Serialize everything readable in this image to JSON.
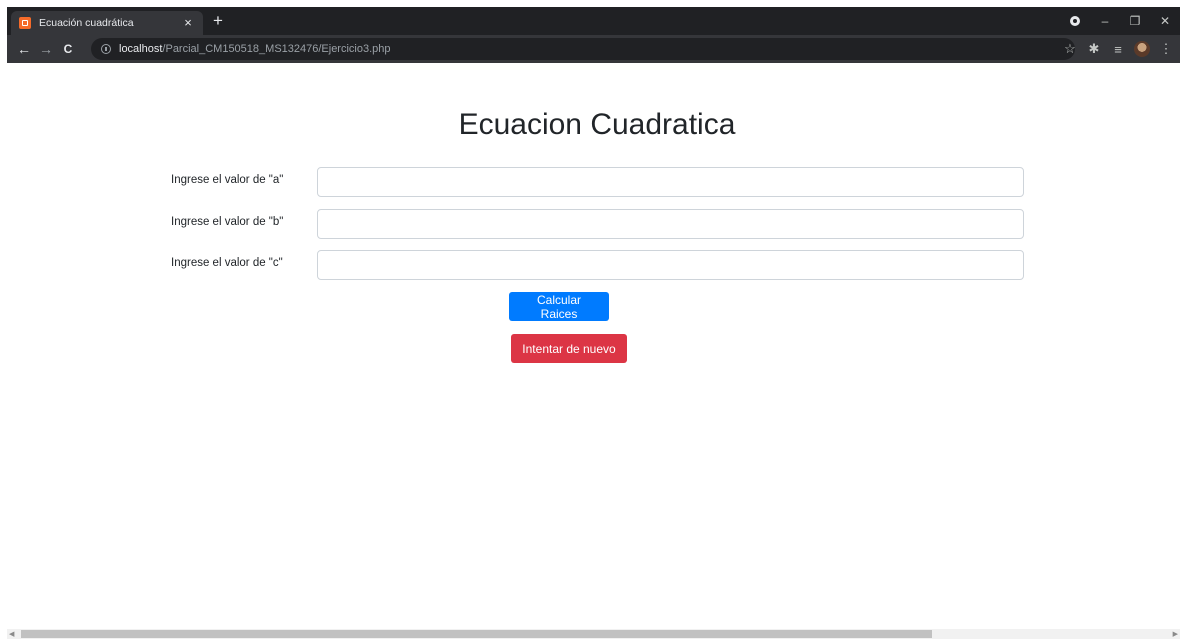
{
  "browser": {
    "tab_title": "Ecuación cuadrática",
    "tab_close": "×",
    "new_tab": "+",
    "url_host": "localhost",
    "url_path": "/Parcial_CM150518_MS132476/Ejercicio3.php",
    "nav": {
      "back": "←",
      "forward": "→",
      "reload": "C"
    },
    "window": {
      "minimize": "–",
      "restore": "❐",
      "close": "✕"
    },
    "toolbar_icons": {
      "star": "☆",
      "extensions": "✱",
      "reading_list": "≡",
      "menu": "⋮"
    }
  },
  "page": {
    "title": "Ecuacion Cuadratica",
    "fields": [
      {
        "label": "Ingrese el valor de \"a\"",
        "value": ""
      },
      {
        "label": "Ingrese el valor de \"b\"",
        "value": ""
      },
      {
        "label": "Ingrese el valor de \"c\"",
        "value": ""
      }
    ],
    "calculate_label": "Calcular Raices",
    "reset_label": "Intentar de nuevo"
  },
  "colors": {
    "primary": "#007bff",
    "danger": "#dc3545",
    "chrome_dark": "#202124",
    "chrome_toolbar": "#35363a"
  }
}
